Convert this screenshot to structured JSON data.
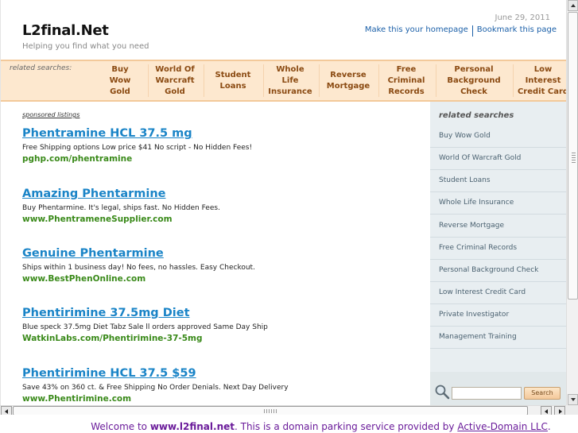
{
  "header": {
    "site_title": "L2final.Net",
    "tagline": "Helping you find what you need",
    "date": "June 29, 2011",
    "make_homepage": "Make this your homepage",
    "bookmark": "Bookmark this page"
  },
  "category_bar": {
    "label": "related searches:",
    "items": [
      {
        "label": "Buy\nWow\nGold"
      },
      {
        "label": "World Of\nWarcraft\nGold"
      },
      {
        "label": "Student\nLoans"
      },
      {
        "label": "Whole\nLife\nInsurance"
      },
      {
        "label": "Reverse\nMortgage"
      },
      {
        "label": "Free\nCriminal\nRecords"
      },
      {
        "label": "Personal\nBackground\nCheck"
      },
      {
        "label": "Low\nInterest\nCredit Card"
      }
    ]
  },
  "results": {
    "sponsored_label": "sponsored listings",
    "items": [
      {
        "title": "Phentramine HCL 37.5 mg",
        "desc": "Free Shipping options Low price $41 No script - No Hidden Fees!",
        "url": "pghp.com/phentramine"
      },
      {
        "title": "Amazing Phentarmine",
        "desc": "Buy Phentarmine. It's legal, ships fast. No Hidden Fees.",
        "url": "www.PhentrameneSupplier.com"
      },
      {
        "title": "Genuine Phentarmine",
        "desc": "Ships within 1 business day! No fees, no hassles. Easy Checkout.",
        "url": "www.BestPhenOnline.com"
      },
      {
        "title": "Phentirimine 37.5mg Diet",
        "desc": "Blue speck 37.5mg Diet Tabz Sale ll orders approved Same Day Ship",
        "url": "WatkinLabs.com/Phentirimine-37-5mg"
      },
      {
        "title": "Phentirimine HCL 37.5 $59",
        "desc": "Save 43% on 360 ct. & Free Shipping No Order Denials. Next Day Delivery",
        "url": "www.Phentirimine.com"
      }
    ]
  },
  "sidebar": {
    "title": "related searches",
    "items": [
      {
        "label": "Buy Wow Gold"
      },
      {
        "label": "World Of Warcraft Gold"
      },
      {
        "label": "Student Loans"
      },
      {
        "label": "Whole Life Insurance"
      },
      {
        "label": "Reverse Mortgage"
      },
      {
        "label": "Free Criminal Records"
      },
      {
        "label": "Personal Background Check"
      },
      {
        "label": "Low Interest Credit Card"
      },
      {
        "label": "Private Investigator"
      },
      {
        "label": "Management Training"
      }
    ],
    "search_button": "Search",
    "search_value": ""
  },
  "footer": {
    "prefix": "Welcome to ",
    "domain": "www.l2final.net",
    "middle": ". This is a domain parking service provided by ",
    "provider": "Active-Domain LLC",
    "suffix": "."
  },
  "colors": {
    "accent_link": "#1a84c7",
    "url_green": "#3a8a1a",
    "category_bg": "#fde8cf",
    "category_text": "#8a4a12",
    "footer_text": "#6a1b9a"
  },
  "icons": {
    "search": "magnifier-icon"
  }
}
